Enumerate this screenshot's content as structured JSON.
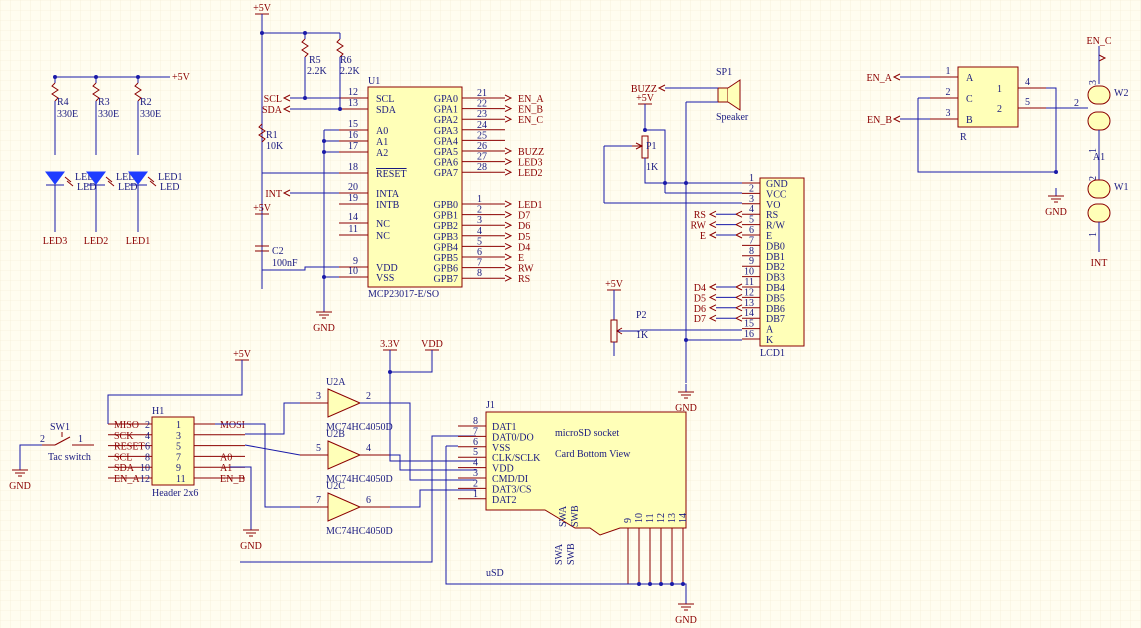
{
  "u1": {
    "designator": "U1",
    "part": "MCP23017-E/SO",
    "left_pins": [
      {
        "num": "12",
        "name": "SCL"
      },
      {
        "num": "13",
        "name": "SDA"
      },
      {
        "num": "15",
        "name": "A0"
      },
      {
        "num": "16",
        "name": "A1"
      },
      {
        "num": "17",
        "name": "A2"
      },
      {
        "num": "18",
        "name": "RESET"
      },
      {
        "num": "20",
        "name": "INTA"
      },
      {
        "num": "19",
        "name": "INTB"
      },
      {
        "num": "14",
        "name": "NC"
      },
      {
        "num": "11",
        "name": "NC"
      },
      {
        "num": "9",
        "name": "VDD"
      },
      {
        "num": "10",
        "name": "VSS"
      }
    ],
    "gpa": [
      {
        "num": "21",
        "name": "GPA0",
        "net": "EN_A"
      },
      {
        "num": "22",
        "name": "GPA1",
        "net": "EN_B"
      },
      {
        "num": "23",
        "name": "GPA2",
        "net": "EN_C"
      },
      {
        "num": "24",
        "name": "GPA3",
        "net": ""
      },
      {
        "num": "25",
        "name": "GPA4",
        "net": ""
      },
      {
        "num": "26",
        "name": "GPA5",
        "net": "BUZZ"
      },
      {
        "num": "27",
        "name": "GPA6",
        "net": "LED3"
      },
      {
        "num": "28",
        "name": "GPA7",
        "net": "LED2"
      }
    ],
    "gpb": [
      {
        "num": "1",
        "name": "GPB0",
        "net": "LED1"
      },
      {
        "num": "2",
        "name": "GPB1",
        "net": "D7"
      },
      {
        "num": "3",
        "name": "GPB2",
        "net": "D6"
      },
      {
        "num": "4",
        "name": "GPB3",
        "net": "D5"
      },
      {
        "num": "5",
        "name": "GPB4",
        "net": "D4"
      },
      {
        "num": "6",
        "name": "GPB5",
        "net": "E"
      },
      {
        "num": "7",
        "name": "GPB6",
        "net": "RW"
      },
      {
        "num": "8",
        "name": "GPB7",
        "net": "RS"
      }
    ]
  },
  "lcd": {
    "designator": "LCD1",
    "pins": [
      {
        "num": "1",
        "name": "GND",
        "net": ""
      },
      {
        "num": "2",
        "name": "VCC",
        "net": ""
      },
      {
        "num": "3",
        "name": "VO",
        "net": ""
      },
      {
        "num": "4",
        "name": "RS",
        "net": "RS"
      },
      {
        "num": "5",
        "name": "R/W",
        "net": "RW"
      },
      {
        "num": "6",
        "name": "E",
        "net": "E"
      },
      {
        "num": "7",
        "name": "DB0",
        "net": ""
      },
      {
        "num": "8",
        "name": "DB1",
        "net": ""
      },
      {
        "num": "9",
        "name": "DB2",
        "net": ""
      },
      {
        "num": "10",
        "name": "DB3",
        "net": ""
      },
      {
        "num": "11",
        "name": "DB4",
        "net": "D4"
      },
      {
        "num": "12",
        "name": "DB5",
        "net": "D5"
      },
      {
        "num": "13",
        "name": "DB6",
        "net": "D6"
      },
      {
        "num": "14",
        "name": "DB7",
        "net": "D7"
      },
      {
        "num": "15",
        "name": "A",
        "net": ""
      },
      {
        "num": "16",
        "name": "K",
        "net": ""
      }
    ]
  },
  "header": {
    "designator": "H1",
    "part": "Header 2x6",
    "left_nets": [
      "MISO",
      "SCK",
      "RESET",
      "SCL",
      "SDA",
      "EN_A"
    ],
    "left_nums": [
      "2",
      "4",
      "6",
      "8",
      "10",
      "12"
    ],
    "right_nums": [
      "1",
      "3",
      "5",
      "7",
      "9",
      "11"
    ],
    "right_nets": [
      "MOSI",
      "",
      "",
      "A0",
      "A1",
      "EN_B"
    ]
  },
  "sd": {
    "designator": "J1",
    "title": "microSD socket",
    "subtitle": "Card Bottom View",
    "value": "uSD",
    "pins": [
      {
        "num": "8",
        "name": "DAT1"
      },
      {
        "num": "7",
        "name": "DAT0/DO"
      },
      {
        "num": "6",
        "name": "VSS"
      },
      {
        "num": "5",
        "name": "CLK/SCLK"
      },
      {
        "num": "4",
        "name": "VDD"
      },
      {
        "num": "3",
        "name": "CMD/DI"
      },
      {
        "num": "2",
        "name": "DAT3/CS"
      },
      {
        "num": "1",
        "name": "DAT2"
      }
    ],
    "shield_nums": [
      "9",
      "10",
      "11",
      "12",
      "13",
      "14"
    ],
    "swa": "SWA",
    "swb": "SWB"
  },
  "buffers": [
    {
      "designator": "U2A",
      "part": "MC74HC4050D",
      "in": "3",
      "out": "2"
    },
    {
      "designator": "U2B",
      "part": "MC74HC4050D",
      "in": "5",
      "out": "4"
    },
    {
      "designator": "U2C",
      "part": "MC74HC4050D",
      "in": "7",
      "out": "6"
    }
  ],
  "resistors": [
    {
      "designator": "R4",
      "value": "330E"
    },
    {
      "designator": "R3",
      "value": "330E"
    },
    {
      "designator": "R2",
      "value": "330E"
    },
    {
      "designator": "R5",
      "value": "2.2K"
    },
    {
      "designator": "R6",
      "value": "2.2K"
    },
    {
      "designator": "R1",
      "value": "10K"
    }
  ],
  "leds": [
    {
      "designator": "LED3",
      "net": "LED3"
    },
    {
      "designator": "LED2",
      "net": "LED2"
    },
    {
      "designator": "LED1",
      "net": "LED1"
    }
  ],
  "led_pin_label": "LED",
  "cap": {
    "designator": "C2",
    "value": "100nF"
  },
  "pots": [
    {
      "designator": "P1",
      "value": "1K"
    },
    {
      "designator": "P2",
      "value": "1K"
    }
  ],
  "speaker": {
    "designator": "SP1",
    "value": "Speaker",
    "net": "BUZZ"
  },
  "encoder": {
    "designator": "R",
    "pins": [
      {
        "num": "1",
        "name": "A"
      },
      {
        "num": "2",
        "name": "C"
      },
      {
        "num": "3",
        "name": "B"
      }
    ],
    "sw_pins": [
      {
        "num": "4",
        "name": "1"
      },
      {
        "num": "5",
        "name": "2"
      }
    ],
    "nets": [
      "EN_A",
      "EN_B",
      "EN_C"
    ]
  },
  "wires": {
    "w2": "W2",
    "a1": "A1",
    "w1": "W1",
    "w2_pin": "2",
    "w2_n1": "3",
    "w2_n2": "1",
    "w1_n1": "2",
    "w1_n2": "1"
  },
  "switch": {
    "designator": "SW1",
    "part": "Tac switch",
    "pin1": "1",
    "pin2": "2"
  },
  "power": {
    "p5": "+5V",
    "p33": "3.3V",
    "vdd": "VDD",
    "gnd": "GND"
  },
  "nets": {
    "scl": "SCL",
    "sda": "SDA",
    "int": "INT",
    "buzz": "BUZZ",
    "en_a": "EN_A",
    "en_b": "EN_B",
    "en_c": "EN_C"
  }
}
